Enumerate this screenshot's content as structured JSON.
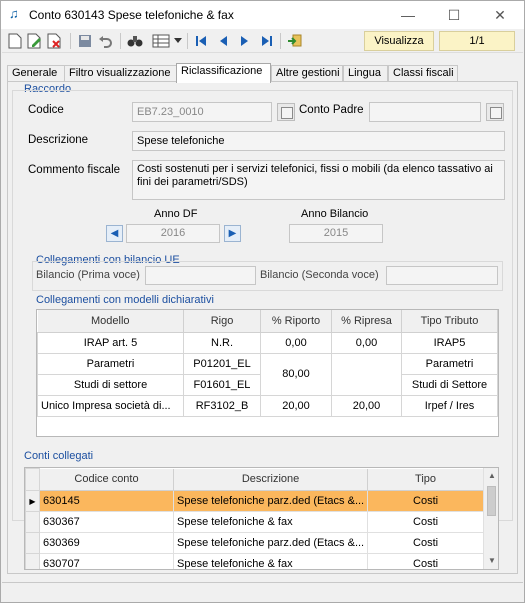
{
  "window": {
    "title": "Conto 630143 Spese telefoniche & fax",
    "minimize": "—",
    "maximize": "☐",
    "close": "✕"
  },
  "toolbar": {
    "mode_label": "Visualizza",
    "page_label": "1/1"
  },
  "tabs": [
    {
      "label": "Generale"
    },
    {
      "label": "Filtro visualizzazione"
    },
    {
      "label": "Riclassificazione"
    },
    {
      "label": "Altre gestioni"
    },
    {
      "label": "Lingua"
    },
    {
      "label": "Classi fiscali"
    }
  ],
  "raccordo": {
    "title": "Raccordo",
    "codice_label": "Codice",
    "codice_value": "EB7.23_0010",
    "conto_padre_label": "Conto Padre",
    "conto_padre_value": "",
    "descrizione_label": "Descrizione",
    "descrizione_value": "Spese telefoniche",
    "commento_label": "Commento fiscale",
    "commento_value": "Costi sostenuti per i servizi telefonici, fissi o mobili (da elenco tassativo ai fini dei parametri/SDS)",
    "anno_df_label": "Anno DF",
    "anno_df_value": "2016",
    "anno_bilancio_label": "Anno Bilancio",
    "anno_bilancio_value": "2015"
  },
  "bilancio_ue": {
    "title": "Collegamenti con bilancio UE",
    "prima_label": "Bilancio (Prima voce)",
    "prima_value": "",
    "seconda_label": "Bilancio (Seconda voce)",
    "seconda_value": ""
  },
  "modelli": {
    "title": "Collegamenti con modelli dichiarativi",
    "headers": [
      "Modello",
      "Rigo",
      "% Riporto",
      "% Ripresa",
      "Tipo Tributo"
    ],
    "rows": [
      {
        "modello": "IRAP art. 5",
        "rigo": "N.R.",
        "riporto": "0,00",
        "ripresa": "0,00",
        "tributo": "IRAP5"
      },
      {
        "modello": "Parametri",
        "rigo": "P01201_EL",
        "riporto": "80,00",
        "ripresa": "",
        "tributo": "Parametri"
      },
      {
        "modello": "Studi di settore",
        "rigo": "F01601_EL",
        "riporto": "",
        "ripresa": "",
        "tributo": "Studi di Settore"
      },
      {
        "modello": "Unico Impresa società di...",
        "rigo": "RF3102_B",
        "riporto": "20,00",
        "ripresa": "20,00",
        "tributo": "Irpef / Ires"
      }
    ]
  },
  "conti": {
    "title": "Conti collegati",
    "headers": [
      "Codice conto",
      "Descrizione",
      "Tipo"
    ],
    "rows": [
      {
        "codice": "630145",
        "descrizione": "Spese telefoniche parz.ded (Etacs &...",
        "tipo": "Costi"
      },
      {
        "codice": "630367",
        "descrizione": "Spese telefoniche & fax",
        "tipo": "Costi"
      },
      {
        "codice": "630369",
        "descrizione": "Spese telefoniche parz.ded (Etacs &...",
        "tipo": "Costi"
      },
      {
        "codice": "630707",
        "descrizione": "Spese telefoniche & fax",
        "tipo": "Costi"
      }
    ],
    "selected_indicator": "▶"
  },
  "colors": {
    "accent_blue": "#1c4fa0",
    "selected_row": "#fbb75d",
    "toolbar_box": "#fbf3c6"
  }
}
